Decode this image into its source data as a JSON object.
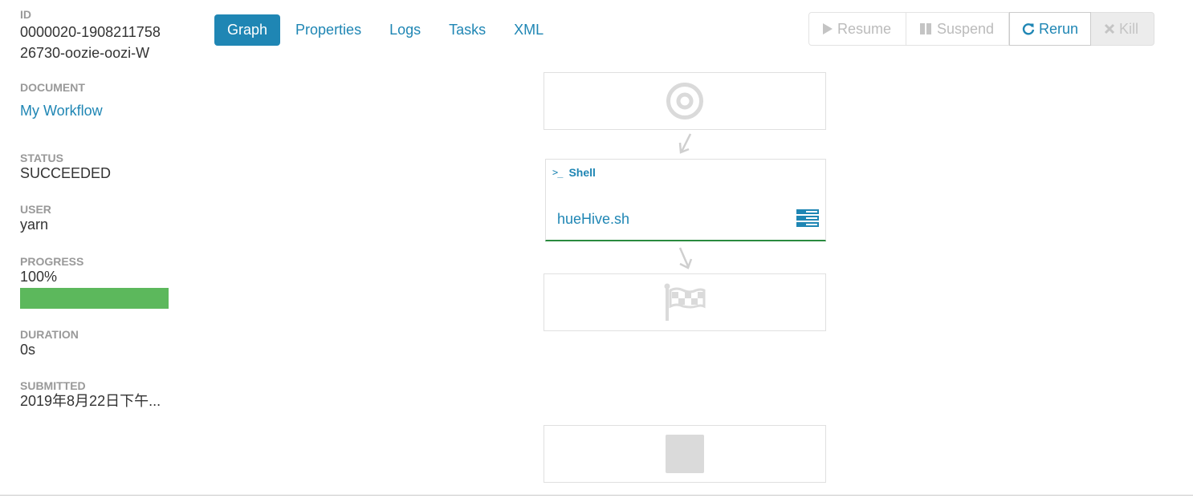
{
  "sidebar": {
    "id_label": "ID",
    "id_value": "0000020-190821175826730-oozie-oozi-W",
    "document_label": "DOCUMENT",
    "document_value": "My Workflow",
    "status_label": "STATUS",
    "status_value": "SUCCEEDED",
    "user_label": "USER",
    "user_value": "yarn",
    "progress_label": "PROGRESS",
    "progress_value": "100%",
    "progress_fraction": 1.0,
    "duration_label": "DURATION",
    "duration_value": "0s",
    "submitted_label": "SUBMITTED",
    "submitted_value": "2019年8月22日下午..."
  },
  "tabs": [
    {
      "label": "Graph",
      "active": true
    },
    {
      "label": "Properties",
      "active": false
    },
    {
      "label": "Logs",
      "active": false
    },
    {
      "label": "Tasks",
      "active": false
    },
    {
      "label": "XML",
      "active": false
    }
  ],
  "actions": {
    "resume_label": "Resume",
    "suspend_label": "Suspend",
    "rerun_label": "Rerun",
    "kill_label": "Kill"
  },
  "graph": {
    "start_icon": "start-target-icon",
    "shell_type": "Shell",
    "shell_script": "hueHive.sh",
    "end_icon": "end-flag-icon",
    "kill_icon": "kill-square-icon",
    "success_color": "#2a8a3f"
  },
  "colors": {
    "accent": "#1f86b4",
    "progress": "#5cb85c"
  }
}
